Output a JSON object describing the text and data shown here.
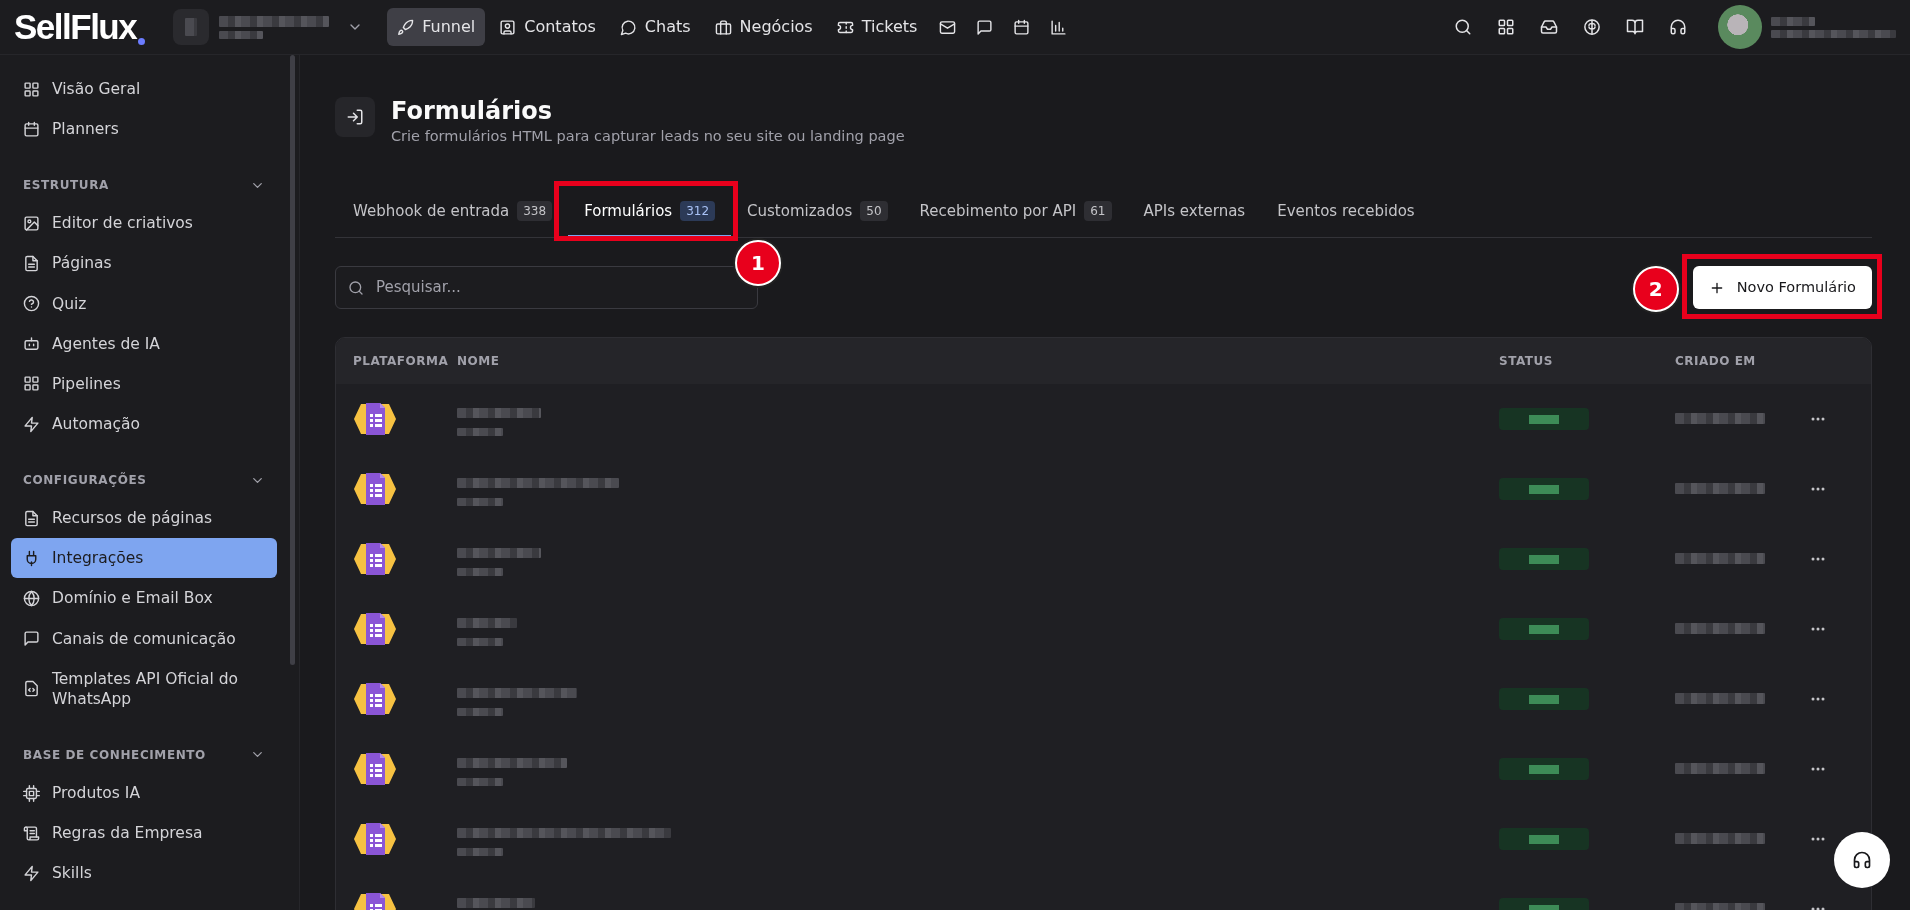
{
  "topbar": {
    "logo": "SellFlux",
    "workspace_blurred": true,
    "nav": [
      {
        "label": "Funnel",
        "selected": true
      },
      {
        "label": "Contatos",
        "selected": false
      },
      {
        "label": "Chats",
        "selected": false
      },
      {
        "label": "Negócios",
        "selected": false
      },
      {
        "label": "Tickets",
        "selected": false
      }
    ],
    "user_blurred": true
  },
  "sidebar": {
    "items": [
      {
        "label": "Visão Geral",
        "selected": false
      },
      {
        "label": "Planners",
        "selected": false
      }
    ],
    "sections": [
      {
        "title": "ESTRUTURA",
        "expanded": true,
        "items": [
          {
            "label": "Editor de criativos",
            "selected": false
          },
          {
            "label": "Páginas",
            "selected": false
          },
          {
            "label": "Quiz",
            "selected": false
          },
          {
            "label": "Agentes de IA",
            "selected": false
          },
          {
            "label": "Pipelines",
            "selected": false
          },
          {
            "label": "Automação",
            "selected": false
          }
        ]
      },
      {
        "title": "CONFIGURAÇÕES",
        "expanded": true,
        "items": [
          {
            "label": "Recursos de páginas",
            "selected": false
          },
          {
            "label": "Integrações",
            "selected": true
          },
          {
            "label": "Domínio e Email Box",
            "selected": false
          },
          {
            "label": "Canais de comunicação",
            "selected": false
          },
          {
            "label": "Templates API Oficial do WhatsApp",
            "selected": false
          }
        ]
      },
      {
        "title": "BASE DE CONHECIMENTO",
        "expanded": true,
        "items": [
          {
            "label": "Produtos IA",
            "selected": false
          },
          {
            "label": "Regras da Empresa",
            "selected": false
          },
          {
            "label": "Skills",
            "selected": false
          }
        ]
      }
    ]
  },
  "page": {
    "title": "Formulários",
    "subtitle": "Crie formulários HTML para capturar leads no seu site ou landing page"
  },
  "tabs": [
    {
      "label": "Webhook de entrada",
      "count": "338",
      "selected": false
    },
    {
      "label": "Formulários",
      "count": "312",
      "selected": true
    },
    {
      "label": "Customizados",
      "count": "50",
      "selected": false
    },
    {
      "label": "Recebimento por API",
      "count": "61",
      "selected": false
    },
    {
      "label": "APIs externas",
      "selected": false
    },
    {
      "label": "Eventos recebidos",
      "selected": false
    }
  ],
  "search": {
    "placeholder": "Pesquisar..."
  },
  "new_button": {
    "label": "Novo Formulário"
  },
  "annotations": [
    {
      "label": "1",
      "kind": "tab"
    },
    {
      "label": "2",
      "kind": "button"
    }
  ],
  "table": {
    "columns": [
      "PLATAFORMA",
      "NOME",
      "STATUS",
      "CRIADO EM"
    ],
    "rows": [
      {
        "blurred": true
      },
      {
        "blurred": true
      },
      {
        "blurred": true
      },
      {
        "blurred": true
      },
      {
        "blurred": true
      },
      {
        "blurred": true
      },
      {
        "blurred": true
      },
      {
        "blurred": true
      }
    ]
  }
}
